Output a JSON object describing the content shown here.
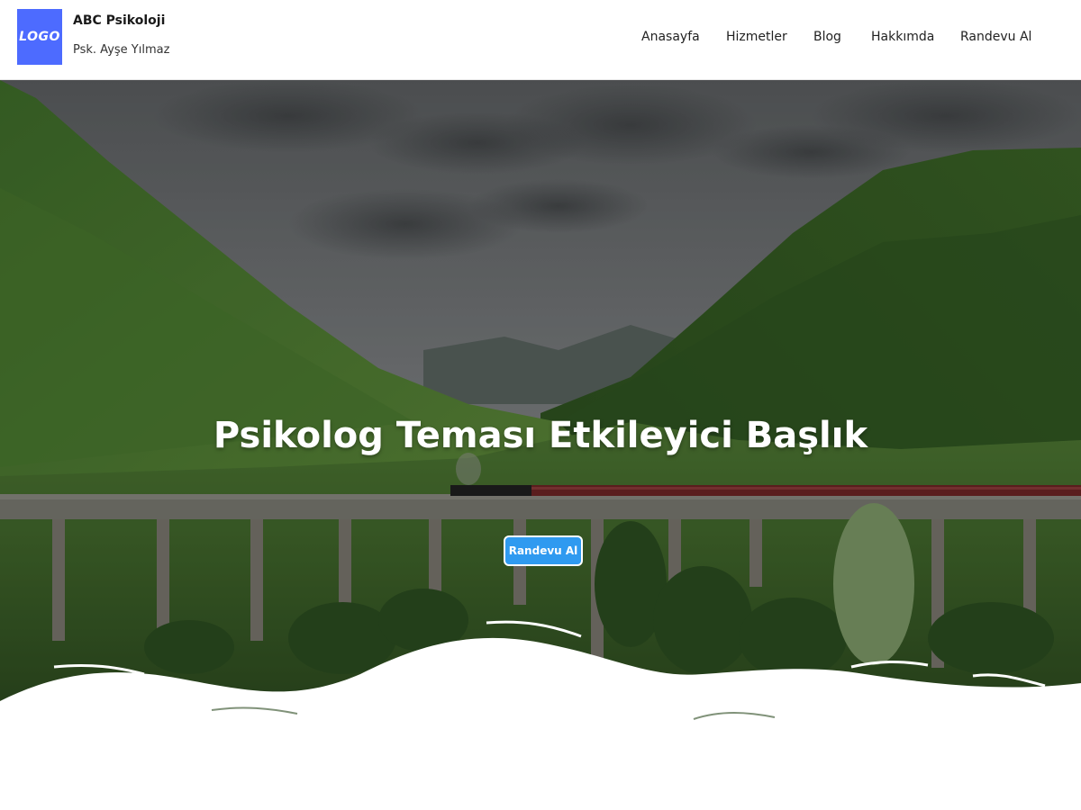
{
  "header": {
    "logo_text": "LOGO",
    "brand_name": "ABC Psikoloji",
    "brand_subtitle": "Psk. Ayşe Yılmaz",
    "nav": [
      {
        "label": "Anasayfa"
      },
      {
        "label": "Hizmetler"
      },
      {
        "label": "Blog"
      },
      {
        "label": "Hakkımda"
      },
      {
        "label": "Randevu Al"
      }
    ]
  },
  "hero": {
    "title": "Psikolog Teması Etkileyici Başlık",
    "cta_label": "Randevu Al",
    "image_subject": "mountain-valley-viaduct-train"
  },
  "colors": {
    "logo_bg": "#4d6bff",
    "cta_bg": "#2f9af0",
    "text_dark": "#222222"
  }
}
